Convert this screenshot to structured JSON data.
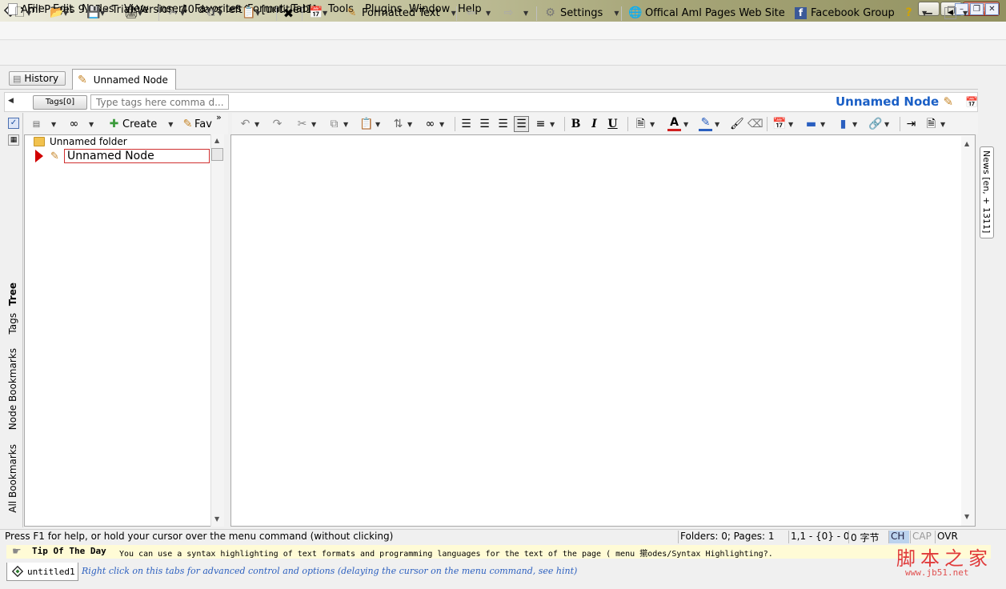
{
  "window": {
    "title": "Aml Pages 9.85 - Trial Version, 40 days left^ - [untitled1]",
    "minimize_glyph": "▁",
    "maximize_glyph": "□",
    "close_glyph": "✕"
  },
  "menu": {
    "items": [
      "File",
      "Edit",
      "Nodes",
      "View",
      "Insert",
      "Favorites",
      "Format",
      "Table",
      "Tools",
      "Plugins",
      "Window",
      "Help"
    ],
    "mdi_controls": [
      "–",
      "❐",
      "✕"
    ]
  },
  "toolbar": {
    "formatted_text": "Formatted Text",
    "settings": "Settings",
    "official_site": "Offical Aml Pages Web Site",
    "facebook": "Facebook Group"
  },
  "tabs": {
    "history": "History",
    "node_tab": "Unnamed Node"
  },
  "tags": {
    "button": "Tags[0]",
    "placeholder": "Type tags here comma d..."
  },
  "node_title": "Unnamed Node",
  "sidebar": {
    "tabs": [
      "Tree",
      "Tags",
      "Node Bookmarks",
      "All Bookmarks"
    ]
  },
  "tree_toolbar": {
    "create": "Create",
    "fav": "Fav"
  },
  "tree": {
    "folder": "Unnamed folder",
    "node": "Unnamed Node"
  },
  "news_tab": "News [en, + 1311]",
  "status": {
    "help": "Press F1 for help, or hold your cursor over the menu command (without clicking)",
    "folders": "Folders: 0; Pages: 1",
    "position": "1,1 - {0} - 0",
    "bytes": "0 字节",
    "ch": "CH",
    "cap": "CAP",
    "ovr": "OVR"
  },
  "tip": {
    "label": "Tip Of The Day",
    "text": "You can use a syntax highlighting of text formats and programming languages for the text of the page ( menu 擶odes/Syntax Highlighting?."
  },
  "doc_tab": "untitled1",
  "hint": "Right click on this tabs for advanced control and options (delaying the cursor on the menu command, see hint)",
  "watermark": {
    "chinese": "脚本之家",
    "url": "www.jb51.net"
  }
}
